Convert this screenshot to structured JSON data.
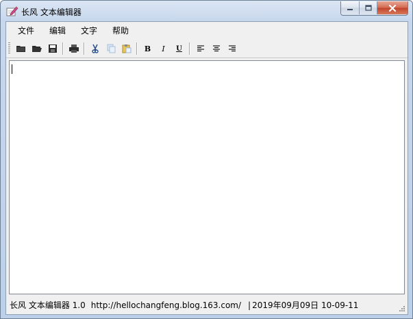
{
  "window": {
    "title": "长风 文本编辑器",
    "app_icon": "pencil-notepad-icon",
    "caption_buttons": [
      "minimize-icon",
      "maximize-icon",
      "close-icon"
    ]
  },
  "menu": {
    "items": [
      {
        "label": "文件"
      },
      {
        "label": "编辑"
      },
      {
        "label": "文字"
      },
      {
        "label": "帮助"
      }
    ]
  },
  "toolbar": {
    "buttons": [
      {
        "icon": "new-folder-icon"
      },
      {
        "icon": "open-folder-icon"
      },
      {
        "icon": "save-floppy-icon"
      },
      {
        "icon": "print-icon"
      },
      {
        "icon": "cut-scissors-icon"
      },
      {
        "icon": "copy-icon"
      },
      {
        "icon": "paste-icon"
      },
      {
        "icon": "bold-icon",
        "label": "B"
      },
      {
        "icon": "italic-icon",
        "label": "I"
      },
      {
        "icon": "underline-icon",
        "label": "U"
      },
      {
        "icon": "align-left-icon"
      },
      {
        "icon": "align-center-icon"
      },
      {
        "icon": "align-right-icon"
      }
    ]
  },
  "editor": {
    "value": ""
  },
  "status": {
    "app_label": "长风 文本编辑器 1.0",
    "url": "http://hellochangfeng.blog.163.com/",
    "separator": "|",
    "date_time": "2019年09月09日 10-09-11"
  },
  "colors": {
    "frame": "#bcd0e9",
    "close_button": "#c2432a",
    "client": "#f0f0f0"
  }
}
